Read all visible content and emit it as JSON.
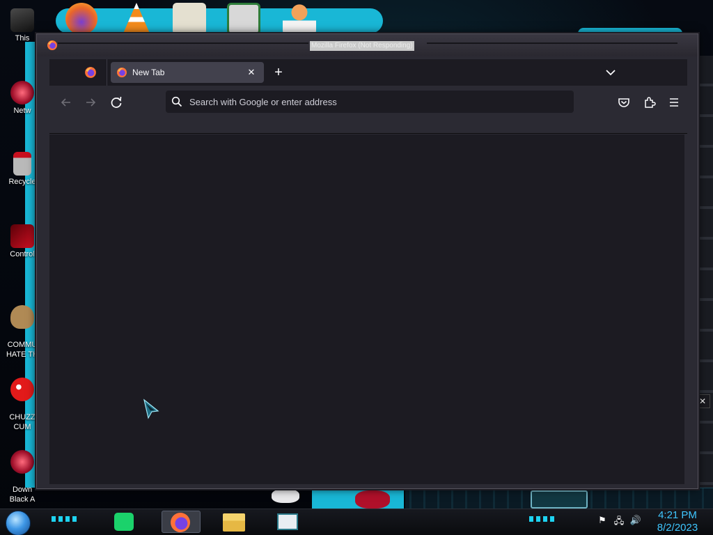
{
  "desktop": {
    "icons": [
      {
        "label": "This",
        "icon": "computer-icon"
      },
      {
        "label": "Netw",
        "icon": "network-icon"
      },
      {
        "label": "Recycle",
        "icon": "recycle-bin-icon"
      },
      {
        "label": "Control",
        "icon": "control-panel-icon"
      },
      {
        "label": "COMMU\nHATE TH",
        "icon": "money-bag-icon"
      },
      {
        "label": "CHUZZ\nCUM",
        "icon": "chuzzle-icon"
      },
      {
        "label": "Down\nBlack A",
        "icon": "download-icon"
      }
    ],
    "top_icons": [
      "firefox-icon",
      "vlc-icon",
      "hxd-icon",
      "app-icon",
      "user-icon"
    ]
  },
  "window": {
    "title": "Mozilla Firefox (Not Responding)",
    "tabs": [
      {
        "label": "New Tab",
        "active": true
      }
    ],
    "new_tab_label": "+",
    "close_tab_label": "✕",
    "urlbar": {
      "placeholder": "Search with Google or enter address",
      "value": ""
    },
    "toolbar": {
      "back": "back-icon",
      "forward": "forward-icon",
      "reload": "reload-icon",
      "pocket": "pocket-icon",
      "extensions": "extensions-icon",
      "menu": "hamburger-menu-icon"
    }
  },
  "taskbar": {
    "apps": [
      {
        "name": "Notes",
        "icon": "notes-icon",
        "active": false
      },
      {
        "name": "Firefox",
        "icon": "firefox-icon",
        "active": true
      },
      {
        "name": "File Explorer",
        "icon": "folder-icon",
        "active": false
      },
      {
        "name": "Document",
        "icon": "document-icon",
        "active": false
      }
    ],
    "tray": [
      "action-center-flag-icon",
      "network-icon",
      "volume-icon"
    ],
    "clock": {
      "time": "4:21 PM",
      "date": "8/2/2023"
    }
  },
  "side_close_label": "✕",
  "colors": {
    "toolbar": "#2b2a33",
    "tabstrip": "#1c1b22",
    "active_tab": "#42414d",
    "clock": "#3fc6ff",
    "accent_cyan": "#1ed3f1"
  }
}
